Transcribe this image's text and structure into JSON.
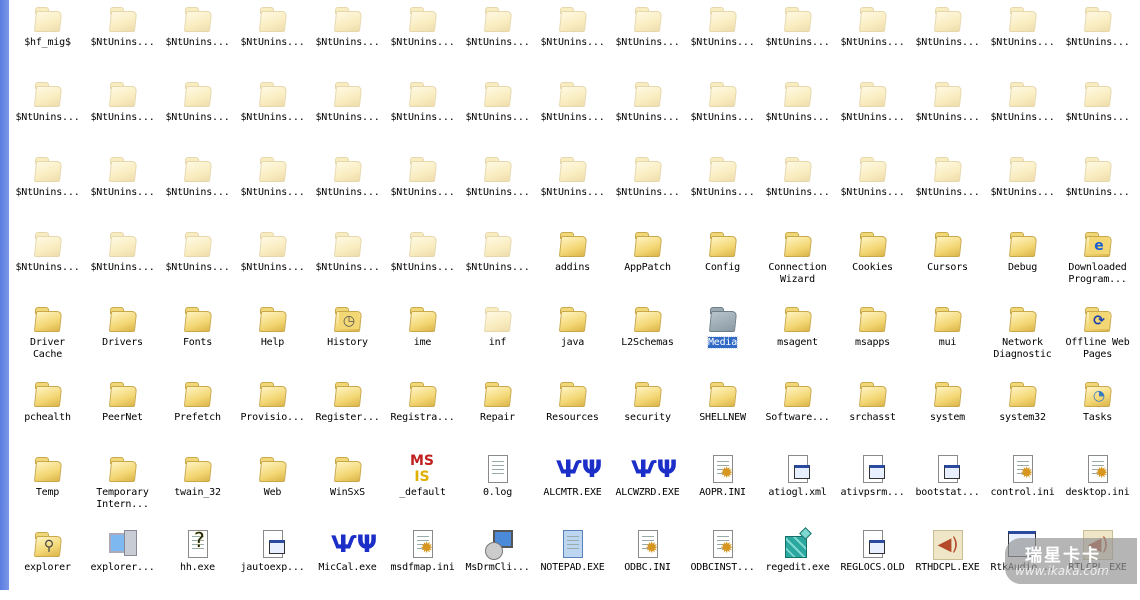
{
  "items": [
    {
      "label": "$hf_mig$",
      "icon": "folder-hidden"
    },
    {
      "label": "$NtUnins...",
      "icon": "folder-hidden"
    },
    {
      "label": "$NtUnins...",
      "icon": "folder-hidden"
    },
    {
      "label": "$NtUnins...",
      "icon": "folder-hidden"
    },
    {
      "label": "$NtUnins...",
      "icon": "folder-hidden"
    },
    {
      "label": "$NtUnins...",
      "icon": "folder-hidden"
    },
    {
      "label": "$NtUnins...",
      "icon": "folder-hidden"
    },
    {
      "label": "$NtUnins...",
      "icon": "folder-hidden"
    },
    {
      "label": "$NtUnins...",
      "icon": "folder-hidden"
    },
    {
      "label": "$NtUnins...",
      "icon": "folder-hidden"
    },
    {
      "label": "$NtUnins...",
      "icon": "folder-hidden"
    },
    {
      "label": "$NtUnins...",
      "icon": "folder-hidden"
    },
    {
      "label": "$NtUnins...",
      "icon": "folder-hidden"
    },
    {
      "label": "$NtUnins...",
      "icon": "folder-hidden"
    },
    {
      "label": "$NtUnins...",
      "icon": "folder-hidden"
    },
    {
      "label": "$NtUnins...",
      "icon": "folder-hidden"
    },
    {
      "label": "$NtUnins...",
      "icon": "folder-hidden"
    },
    {
      "label": "$NtUnins...",
      "icon": "folder-hidden"
    },
    {
      "label": "$NtUnins...",
      "icon": "folder-hidden"
    },
    {
      "label": "$NtUnins...",
      "icon": "folder-hidden"
    },
    {
      "label": "$NtUnins...",
      "icon": "folder-hidden"
    },
    {
      "label": "$NtUnins...",
      "icon": "folder-hidden"
    },
    {
      "label": "$NtUnins...",
      "icon": "folder-hidden"
    },
    {
      "label": "$NtUnins...",
      "icon": "folder-hidden"
    },
    {
      "label": "$NtUnins...",
      "icon": "folder-hidden"
    },
    {
      "label": "$NtUnins...",
      "icon": "folder-hidden"
    },
    {
      "label": "$NtUnins...",
      "icon": "folder-hidden"
    },
    {
      "label": "$NtUnins...",
      "icon": "folder-hidden"
    },
    {
      "label": "$NtUnins...",
      "icon": "folder-hidden"
    },
    {
      "label": "$NtUnins...",
      "icon": "folder-hidden"
    },
    {
      "label": "$NtUnins...",
      "icon": "folder-hidden"
    },
    {
      "label": "$NtUnins...",
      "icon": "folder-hidden"
    },
    {
      "label": "$NtUnins...",
      "icon": "folder-hidden"
    },
    {
      "label": "$NtUnins...",
      "icon": "folder-hidden"
    },
    {
      "label": "$NtUnins...",
      "icon": "folder-hidden"
    },
    {
      "label": "$NtUnins...",
      "icon": "folder-hidden"
    },
    {
      "label": "$NtUnins...",
      "icon": "folder-hidden"
    },
    {
      "label": "$NtUnins...",
      "icon": "folder-hidden"
    },
    {
      "label": "$NtUnins...",
      "icon": "folder-hidden"
    },
    {
      "label": "$NtUnins...",
      "icon": "folder-hidden"
    },
    {
      "label": "$NtUnins...",
      "icon": "folder-hidden"
    },
    {
      "label": "$NtUnins...",
      "icon": "folder-hidden"
    },
    {
      "label": "$NtUnins...",
      "icon": "folder-hidden"
    },
    {
      "label": "$NtUnins...",
      "icon": "folder-hidden"
    },
    {
      "label": "$NtUnins...",
      "icon": "folder-hidden"
    },
    {
      "label": "$NtUnins...",
      "icon": "folder-hidden"
    },
    {
      "label": "$NtUnins...",
      "icon": "folder-hidden"
    },
    {
      "label": "$NtUnins...",
      "icon": "folder-hidden"
    },
    {
      "label": "$NtUnins...",
      "icon": "folder-hidden"
    },
    {
      "label": "$NtUnins...",
      "icon": "folder-hidden"
    },
    {
      "label": "$NtUnins...",
      "icon": "folder-hidden"
    },
    {
      "label": "$NtUnins...",
      "icon": "folder-hidden"
    },
    {
      "label": "addins",
      "icon": "folder"
    },
    {
      "label": "AppPatch",
      "icon": "folder"
    },
    {
      "label": "Config",
      "icon": "folder"
    },
    {
      "label": "Connection\nWizard",
      "icon": "folder"
    },
    {
      "label": "Cookies",
      "icon": "folder"
    },
    {
      "label": "Cursors",
      "icon": "folder"
    },
    {
      "label": "Debug",
      "icon": "folder"
    },
    {
      "label": "Downloaded\nProgram...",
      "icon": "folder-ie"
    },
    {
      "label": "Driver\nCache",
      "icon": "folder"
    },
    {
      "label": "Drivers",
      "icon": "folder"
    },
    {
      "label": "Fonts",
      "icon": "folder"
    },
    {
      "label": "Help",
      "icon": "folder"
    },
    {
      "label": "History",
      "icon": "folder-history"
    },
    {
      "label": "ime",
      "icon": "folder"
    },
    {
      "label": "inf",
      "icon": "folder-hidden"
    },
    {
      "label": "java",
      "icon": "folder"
    },
    {
      "label": "L2Schemas",
      "icon": "folder"
    },
    {
      "label": "Media",
      "icon": "folder-gray",
      "selected": true
    },
    {
      "label": "msagent",
      "icon": "folder"
    },
    {
      "label": "msapps",
      "icon": "folder"
    },
    {
      "label": "mui",
      "icon": "folder"
    },
    {
      "label": "Network\nDiagnostic",
      "icon": "folder"
    },
    {
      "label": "Offline Web\nPages",
      "icon": "folder-offline"
    },
    {
      "label": "pchealth",
      "icon": "folder"
    },
    {
      "label": "PeerNet",
      "icon": "folder"
    },
    {
      "label": "Prefetch",
      "icon": "folder"
    },
    {
      "label": "Provisio...",
      "icon": "folder"
    },
    {
      "label": "Register...",
      "icon": "folder"
    },
    {
      "label": "Registra...",
      "icon": "folder"
    },
    {
      "label": "Repair",
      "icon": "folder"
    },
    {
      "label": "Resources",
      "icon": "folder"
    },
    {
      "label": "security",
      "icon": "folder"
    },
    {
      "label": "SHELLNEW",
      "icon": "folder"
    },
    {
      "label": "Software...",
      "icon": "folder"
    },
    {
      "label": "srchasst",
      "icon": "folder"
    },
    {
      "label": "system",
      "icon": "folder"
    },
    {
      "label": "system32",
      "icon": "folder"
    },
    {
      "label": "Tasks",
      "icon": "folder-tasks"
    },
    {
      "label": "Temp",
      "icon": "folder"
    },
    {
      "label": "Temporary\nIntern...",
      "icon": "folder"
    },
    {
      "label": "twain_32",
      "icon": "folder"
    },
    {
      "label": "Web",
      "icon": "folder"
    },
    {
      "label": "WinSxS",
      "icon": "folder"
    },
    {
      "label": "_default",
      "icon": "ms-shortcut"
    },
    {
      "label": "0.log",
      "icon": "text-file"
    },
    {
      "label": "ALCMTR.EXE",
      "icon": "realtek"
    },
    {
      "label": "ALCWZRD.EXE",
      "icon": "realtek"
    },
    {
      "label": "AOPR.INI",
      "icon": "ini-file"
    },
    {
      "label": "atiogl.xml",
      "icon": "generic-file"
    },
    {
      "label": "ativpsrm...",
      "icon": "generic-file"
    },
    {
      "label": "bootstat...",
      "icon": "generic-file"
    },
    {
      "label": "control.ini",
      "icon": "ini-file"
    },
    {
      "label": "desktop.ini",
      "icon": "ini-file"
    },
    {
      "label": "explorer",
      "icon": "folder-search"
    },
    {
      "label": "explorer...",
      "icon": "computer"
    },
    {
      "label": "hh.exe",
      "icon": "help-file"
    },
    {
      "label": "jautoexp...",
      "icon": "generic-file"
    },
    {
      "label": "MicCal.exe",
      "icon": "realtek"
    },
    {
      "label": "msdfmap.ini",
      "icon": "ini-file"
    },
    {
      "label": "MsDrmCli...",
      "icon": "installer"
    },
    {
      "label": "NOTEPAD.EXE",
      "icon": "notepad"
    },
    {
      "label": "ODBC.INI",
      "icon": "ini-file"
    },
    {
      "label": "ODBCINST...",
      "icon": "ini-file"
    },
    {
      "label": "regedit.exe",
      "icon": "regedit"
    },
    {
      "label": "REGLOCS.OLD",
      "icon": "generic-file"
    },
    {
      "label": "RTHDCPL.EXE",
      "icon": "speaker"
    },
    {
      "label": "RtkAudio...",
      "icon": "window-app"
    },
    {
      "label": "RTLCPL.EXE",
      "icon": "speaker"
    }
  ],
  "watermark": {
    "title": "瑞星卡卡",
    "url": "www.ikaka.com"
  }
}
